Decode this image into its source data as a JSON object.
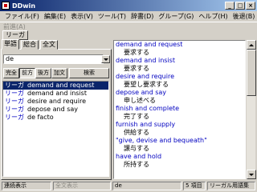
{
  "window": {
    "title": "DDwin",
    "minimize": "_",
    "maximize": "□",
    "close": "×"
  },
  "menu": [
    "ファイル(F)",
    "編集(E)",
    "表示(V)",
    "ツール(T)",
    "辞書(D)",
    "グループ(G)",
    "ヘルプ(H)",
    "後退(B)"
  ],
  "toolbar_disabled": "前進(A)",
  "dictionary_tab": "リーガ",
  "search_tabs": [
    "単語",
    "総合",
    "全文"
  ],
  "search": {
    "value": "de"
  },
  "match_buttons": [
    "完全",
    "前方",
    "後方",
    "加文"
  ],
  "search_button": "検索",
  "results": [
    {
      "dict": "リーガ",
      "term": "demand and request"
    },
    {
      "dict": "リーガ",
      "term": "demand and insist"
    },
    {
      "dict": "リーガ",
      "term": "desire and require"
    },
    {
      "dict": "リーガ",
      "term": "depose and say"
    },
    {
      "dict": "リーガ",
      "term": "de facto"
    }
  ],
  "entries": [
    {
      "head": "demand and request",
      "body": "要求する"
    },
    {
      "head": "demand and insist",
      "body": "要求する"
    },
    {
      "head": "desire and require",
      "body": "要望し要求する"
    },
    {
      "head": "depose and say",
      "body": "申し述べる"
    },
    {
      "head": "finish and complete",
      "body": "完了する"
    },
    {
      "head": "furnish and supply",
      "body": "供給する"
    },
    {
      "head": "\"give, devise and bequeath\"",
      "body": "譲与する"
    },
    {
      "head": "have and hold",
      "body": "所持する"
    }
  ],
  "status": {
    "left": "連続表示",
    "left_disabled": "全文表示",
    "query": "de",
    "count": "5 項目",
    "dictionary": "リーガル用語集"
  }
}
